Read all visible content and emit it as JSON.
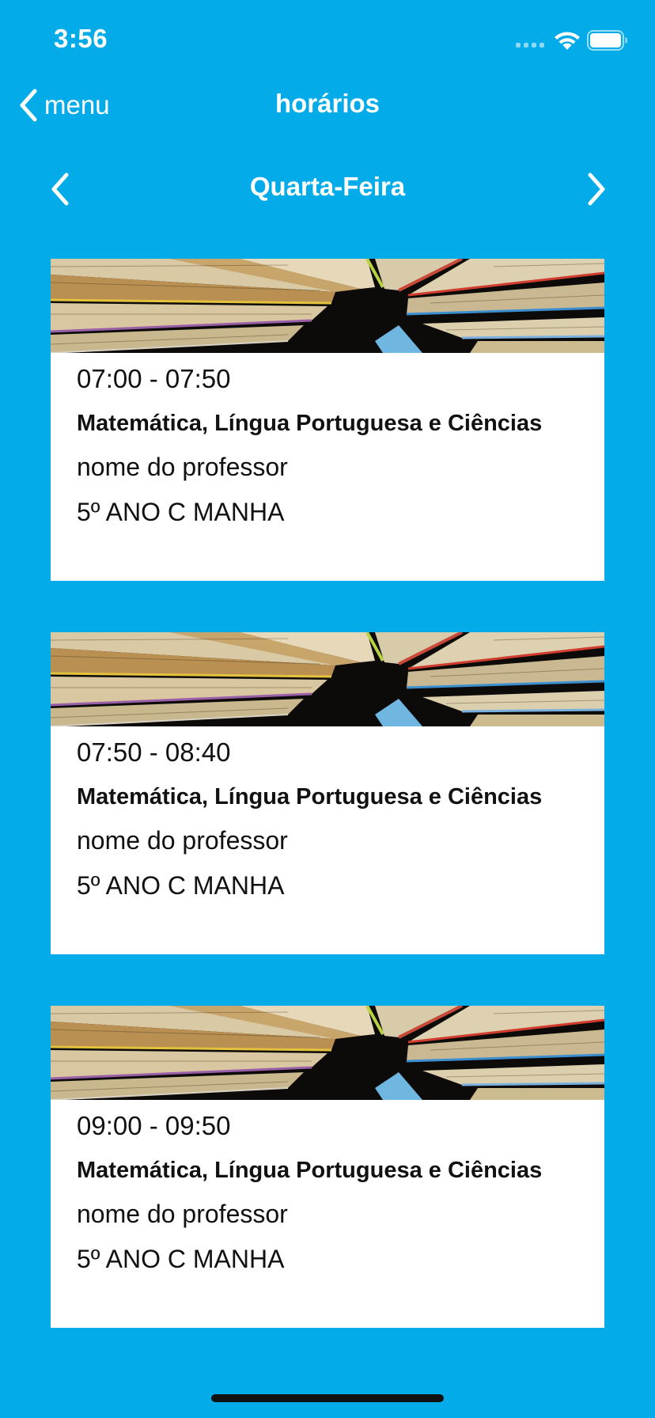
{
  "status_bar": {
    "time": "3:56"
  },
  "nav": {
    "back_label": "menu",
    "title": "horários"
  },
  "day_selector": {
    "day": "Quarta-Feira"
  },
  "colors": {
    "background": "#03ACE8",
    "card": "#FFFFFF",
    "text_light": "#FFFFFF",
    "text_dark": "#111111"
  },
  "icons": {
    "back": "chevron-left-icon",
    "prev_day": "chevron-left-icon",
    "next_day": "chevron-right-icon",
    "wifi": "wifi-icon",
    "battery": "battery-icon",
    "signal": "signal-icon"
  },
  "schedule": [
    {
      "time": "07:00 - 07:50",
      "subject": "Matemática, Língua Portuguesa e Ciências",
      "teacher": "nome do professor",
      "class": "5º ANO C MANHA"
    },
    {
      "time": "07:50 - 08:40",
      "subject": "Matemática, Língua Portuguesa e Ciências",
      "teacher": "nome do professor",
      "class": "5º ANO C MANHA"
    },
    {
      "time": "09:00 - 09:50",
      "subject": "Matemática, Língua Portuguesa e Ciências",
      "teacher": "nome do professor",
      "class": "5º ANO C MANHA"
    }
  ]
}
